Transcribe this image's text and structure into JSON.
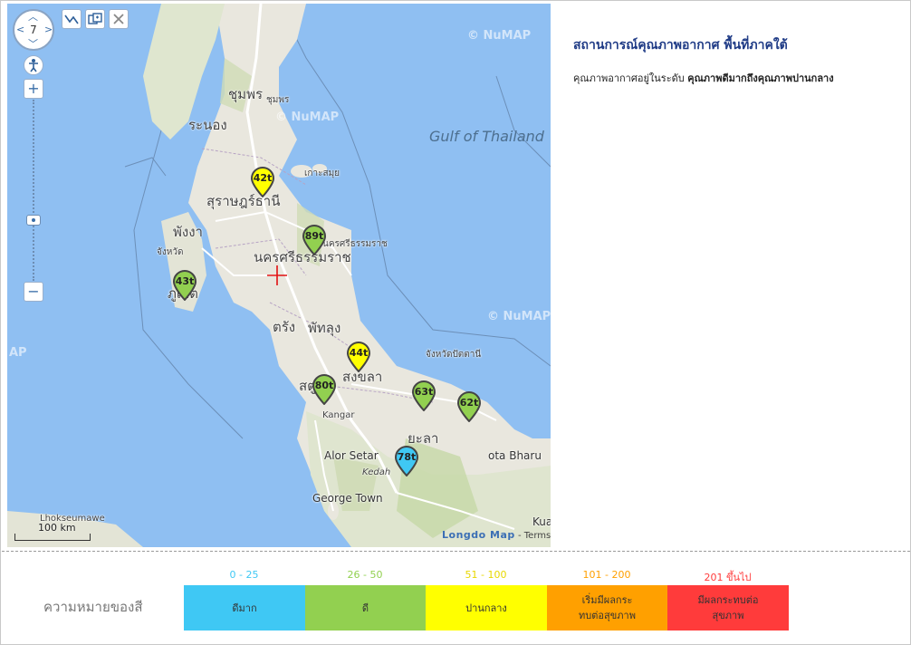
{
  "map": {
    "zoom_level": "7",
    "labels": {
      "chumphon": "ชุมพร",
      "chumphon_small": "ชุมพร",
      "ranong": "ระนอง",
      "surat": "สุราษฎร์ธานี",
      "surat_small": "สุราษฎร์",
      "phangnga": "พังงา",
      "phuket": "ภูเก็ต",
      "krabi": "จังหวัด",
      "nakhon": "นครศรีธรรมราช",
      "nakhon_small": "นครศรีธรรมราช",
      "trang": "ตรัง",
      "phatthalung": "พัทลุง",
      "songkhla": "สงขลา",
      "satun": "สตูล",
      "yala": "ยะลา",
      "pattani": "จังหวัดปัตตานี",
      "kangar": "Kangar",
      "alor_setar": "Alor Setar",
      "kedah": "Kedah",
      "george_town": "George Town",
      "kota_bharu": "ota Bharu",
      "kua": "Kua",
      "lhokseumawe": "Lhokseumawe",
      "gulf": "Gulf of Thailand",
      "ko": "เกาะสมุย",
      "wm1": "© NuMAP",
      "wm2": "© NuMAP",
      "wm3": "© NuMAP",
      "wm4": "AP"
    },
    "scale_label": "100 km",
    "attribution_logo": "Longdo Map",
    "attribution_terms": "- Terms"
  },
  "markers": [
    {
      "label": "42t",
      "color": "#ffff00"
    },
    {
      "label": "89t",
      "color": "#92d050"
    },
    {
      "label": "43t",
      "color": "#92d050"
    },
    {
      "label": "44t",
      "color": "#ffff00"
    },
    {
      "label": "80t",
      "color": "#92d050"
    },
    {
      "label": "63t",
      "color": "#92d050"
    },
    {
      "label": "62t",
      "color": "#92d050"
    },
    {
      "label": "78t",
      "color": "#3fc8f4"
    }
  ],
  "panel": {
    "title": "สถานการณ์คุณภาพอากาศ พื้นที่ภาคใต้",
    "desc_prefix": "คุณภาพอากาศอยู่ในระดับ ",
    "desc_strong": "คุณภาพดีมากถึงคุณภาพปานกลาง"
  },
  "legend": {
    "title": "ความหมายของสี",
    "items": [
      {
        "range": "0 - 25",
        "label": "ดีมาก",
        "color": "#3fc8f4",
        "range_color": "#3fc8f4"
      },
      {
        "range": "26 - 50",
        "label": "ดี",
        "color": "#92d050",
        "range_color": "#92d050"
      },
      {
        "range": "51 - 100",
        "label": "ปานกลาง",
        "color": "#ffff00",
        "range_color": "#e8d800"
      },
      {
        "range": "101 - 200",
        "label": "เริ่มมีผลกระทบต่อสุขภาพ",
        "color": "#ffa000",
        "range_color": "#ffa000"
      },
      {
        "range": "201 ขึ้นไป",
        "label": "มีผลกระทบต่อสุขภาพ",
        "color": "#ff3b3b",
        "range_color": "#ff3b3b"
      }
    ]
  }
}
